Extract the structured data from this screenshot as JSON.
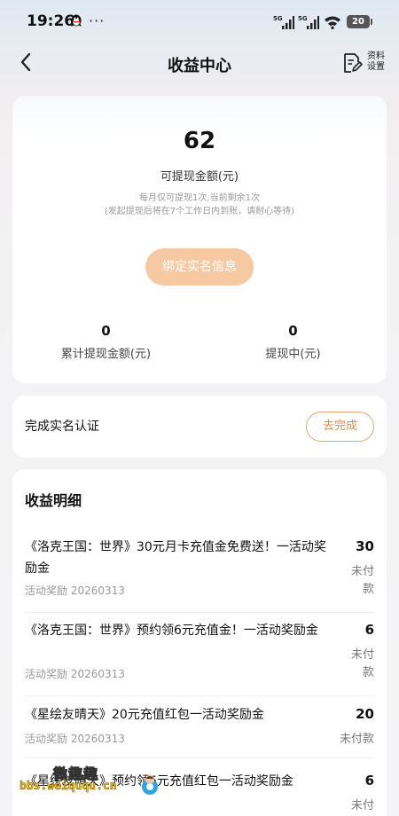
{
  "status_bar": {
    "time": "19:26",
    "more": "···",
    "network1": "5G",
    "network2": "5G",
    "battery": "20"
  },
  "nav": {
    "title": "收益中心",
    "profile_settings": "资料设置"
  },
  "balance": {
    "amount": "62",
    "label": "可提现金额(元)",
    "note1": "每月仅可提现1次,当前剩余1次",
    "note2": "(发起提现后将在7个工作日内到账，请耐心等待)",
    "bind_button": "绑定实名信息",
    "total_withdrawn_value": "0",
    "total_withdrawn_label": "累计提现金额(元)",
    "withdrawing_value": "0",
    "withdrawing_label": "提现中(元)"
  },
  "verify": {
    "text": "完成实名认证",
    "button": "去完成"
  },
  "details": {
    "title": "收益明细",
    "items": [
      {
        "title": "《洛克王国：世界》30元月卡充值金免费送！一活动奖励金",
        "type": "活动奖励",
        "date": "20260313",
        "amount": "30",
        "status": "未付款"
      },
      {
        "title": "《洛克王国：世界》预约领6元充值金！一活动奖励金",
        "type": "活动奖励",
        "date": "20260313",
        "amount": "6",
        "status": "未付款"
      },
      {
        "title": "《星绘友晴天》20元充值红包一活动奖励金",
        "type": "活动奖励",
        "date": "20260313",
        "amount": "20",
        "status": "未付款"
      },
      {
        "title": "《星绘友晴天》预约领6元充值红包一活动奖励金",
        "type": "",
        "date": "",
        "amount": "6",
        "status": "未付"
      }
    ]
  },
  "watermark": {
    "cn": "微趣趣",
    "url": "bbs.weiququ.cn"
  },
  "colors": {
    "accent": "#e48a4d",
    "button_disabled": "#f6c9a2"
  }
}
